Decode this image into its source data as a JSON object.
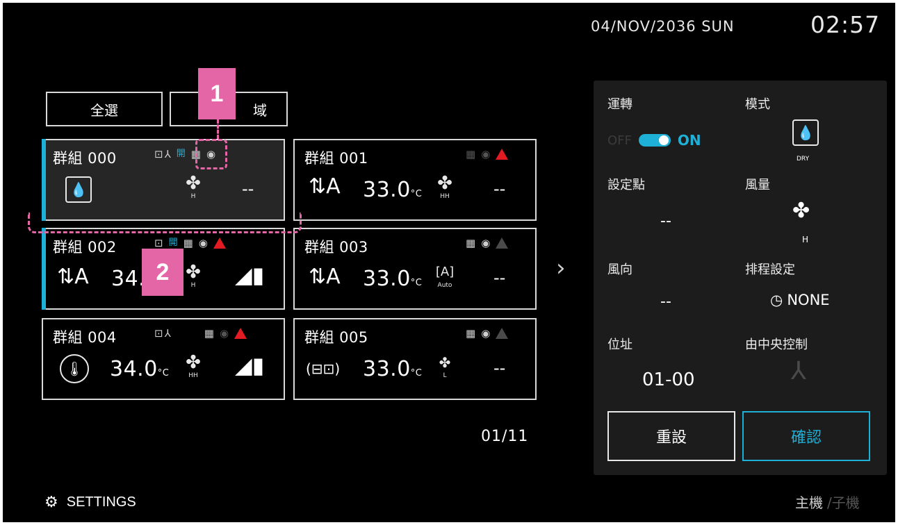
{
  "header": {
    "date": "04/NOV/2036 SUN",
    "time": "02:57"
  },
  "toolbar": {
    "select_all": "全選",
    "region_partial": "域"
  },
  "groups": [
    {
      "name": "群組 000",
      "lock": "開",
      "fan_label": "H",
      "value": "--"
    },
    {
      "name": "群組 001",
      "temp": "33.0",
      "unit": "°C",
      "fan_label": "HH",
      "value": "--"
    },
    {
      "name": "群組 002",
      "lock": "開",
      "temp": "34.",
      "fan_label": "H"
    },
    {
      "name": "群組 003",
      "temp": "33.0",
      "unit": "°C",
      "louver_label": "Auto",
      "value": "--"
    },
    {
      "name": "群組 004",
      "temp": "34.0",
      "unit": "°C",
      "fan_label": "HH"
    },
    {
      "name": "群組 005",
      "temp": "33.0",
      "unit": "°C",
      "fan_label": "L",
      "value": "--"
    }
  ],
  "pager": "01/11",
  "panel": {
    "run_label": "運轉",
    "off": "OFF",
    "on": "ON",
    "mode_label": "模式",
    "mode_value": "DRY",
    "setpoint_label": "設定點",
    "setpoint_value": "--",
    "fan_label": "風量",
    "fan_value": "H",
    "vane_label": "風向",
    "vane_value": "--",
    "schedule_label": "排程設定",
    "schedule_value": "NONE",
    "address_label": "位址",
    "address_value": "01-00",
    "central_label": "由中央控制",
    "reset": "重設",
    "confirm": "確認"
  },
  "footer": {
    "settings": "SETTINGS",
    "main": "主機",
    "sub": "/子機"
  },
  "markers": [
    "1",
    "2"
  ],
  "colors": {
    "accent": "#1fb0d8",
    "warning": "#e21a22",
    "marker": "#e466a6"
  }
}
